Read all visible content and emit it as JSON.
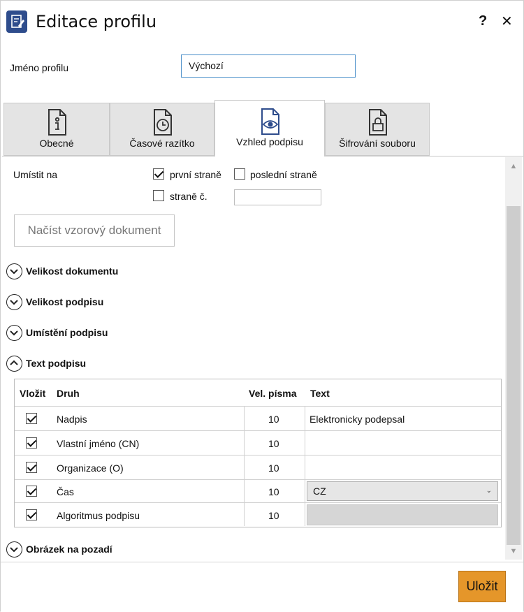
{
  "window": {
    "title": "Editace profilu",
    "help": "?",
    "close": "✕"
  },
  "profile": {
    "name_label": "Jméno profilu",
    "name_value": "Výchozí"
  },
  "tabs": [
    {
      "label": "Obecné",
      "icon": "document-info-icon"
    },
    {
      "label": "Časové razítko",
      "icon": "document-clock-icon"
    },
    {
      "label": "Vzhled podpisu",
      "icon": "document-eye-icon",
      "active": true
    },
    {
      "label": "Šifrování souboru",
      "icon": "document-lock-icon"
    }
  ],
  "placement": {
    "label": "Umístit na",
    "first_page": {
      "label": "první straně",
      "checked": true
    },
    "last_page": {
      "label": "poslední straně",
      "checked": false
    },
    "page_no": {
      "label": "straně č.",
      "checked": false,
      "value": ""
    }
  },
  "load_button": "Načíst vzorový dokument",
  "sections": {
    "doc_size": "Velikost dokumentu",
    "sig_size": "Velikost podpisu",
    "sig_placement": "Umístění podpisu",
    "sig_text": "Text podpisu",
    "background": "Obrázek na pozadí"
  },
  "table": {
    "headers": {
      "insert": "Vložit",
      "kind": "Druh",
      "font_size": "Vel. písma",
      "text": "Text"
    },
    "rows": [
      {
        "checked": true,
        "kind": "Nadpis",
        "size": "10",
        "text": "Elektronicky podepsal"
      },
      {
        "checked": true,
        "kind": "Vlastní jméno (CN)",
        "size": "10",
        "text": ""
      },
      {
        "checked": true,
        "kind": "Organizace (O)",
        "size": "10",
        "text": ""
      },
      {
        "checked": true,
        "kind": "Čas",
        "size": "10",
        "text": "CZ"
      },
      {
        "checked": true,
        "kind": "Algoritmus podpisu",
        "size": "10",
        "text": ""
      }
    ]
  },
  "footer": {
    "save": "Uložit"
  },
  "colors": {
    "accent": "#e5962a",
    "icon_blue": "#2e4c8c",
    "input_border": "#4a8fc9"
  }
}
